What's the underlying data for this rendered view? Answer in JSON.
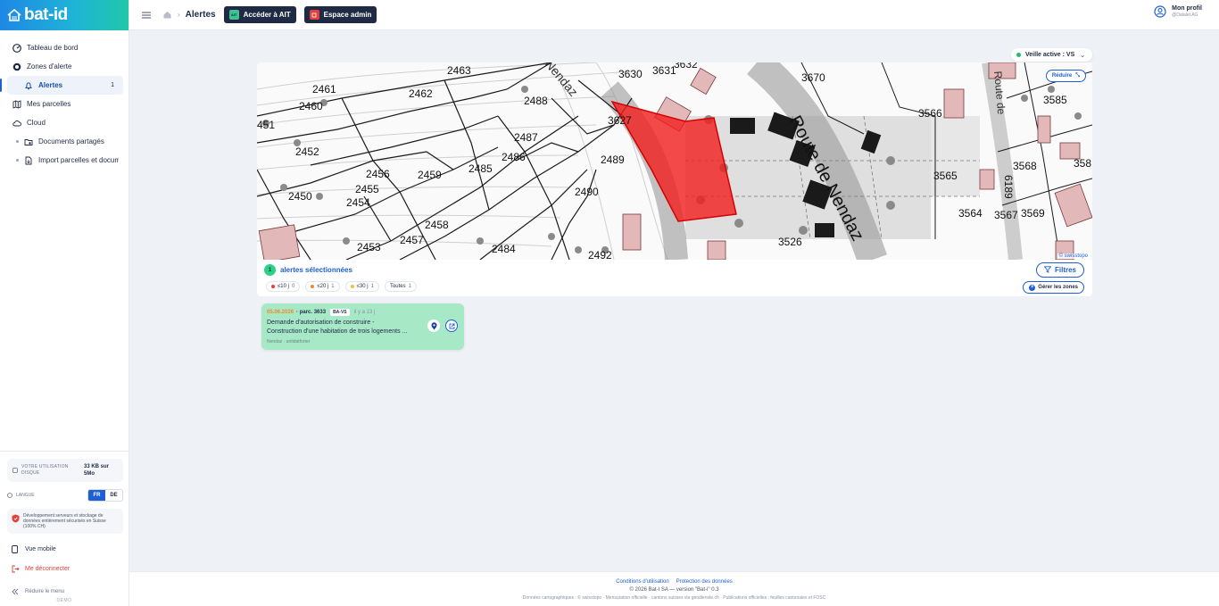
{
  "app": {
    "logo": "bat-id"
  },
  "sidebar": {
    "items": [
      {
        "label": "Tableau de bord",
        "icon": "dashboard-icon"
      },
      {
        "label": "Zones d'alerte",
        "icon": "target-icon"
      },
      {
        "label": "Alertes",
        "icon": "bell-icon",
        "count": "1",
        "active": true
      },
      {
        "label": "Mes parcelles",
        "icon": "map-icon"
      },
      {
        "label": "Cloud",
        "icon": "cloud-icon"
      },
      {
        "label": "Documents partagés",
        "icon": "shared-folder-icon"
      },
      {
        "label": "Import parcelles et documents",
        "icon": "import-file-icon"
      }
    ],
    "disk": {
      "label": "Votre utilisation disque",
      "value": "33 KB sur 5Mo"
    },
    "language": {
      "label": "Langue",
      "options": [
        "FR",
        "DE"
      ],
      "selected": "FR"
    },
    "security_note": "Développement serveurs et stockage de données entièrement sécurisés en Suisse (100% CH)",
    "mobile": "Vue mobile",
    "logout": "Me déconnecter",
    "reduce": "Réduire le menu",
    "env": "DEMO"
  },
  "topbar": {
    "breadcrumb": "Alertes",
    "ait_button": "Accéder à AIT",
    "ait_badge": "AIT",
    "admin_button": "Espace admin",
    "profile_name": "Mon profil",
    "profile_sub": "@Datalet AG"
  },
  "watch": {
    "label": "Veille active : VS"
  },
  "map": {
    "reduce_label": "Réduire",
    "attribution": "© swisstopo",
    "road_labels": [
      "Route de Nendaz",
      "Nendaz",
      "Route de"
    ],
    "parcels": [
      {
        "id": "2463"
      },
      {
        "id": "2461"
      },
      {
        "id": "2462"
      },
      {
        "id": "2460"
      },
      {
        "id": "2488"
      },
      {
        "id": "451"
      },
      {
        "id": "2487"
      },
      {
        "id": "2452"
      },
      {
        "id": "2486"
      },
      {
        "id": "2489"
      },
      {
        "id": "2456"
      },
      {
        "id": "2459"
      },
      {
        "id": "2485"
      },
      {
        "id": "2455"
      },
      {
        "id": "2450"
      },
      {
        "id": "2454"
      },
      {
        "id": "2490"
      },
      {
        "id": "2458"
      },
      {
        "id": "2457"
      },
      {
        "id": "2453"
      },
      {
        "id": "2484"
      },
      {
        "id": "2492"
      },
      {
        "id": "3630"
      },
      {
        "id": "3631"
      },
      {
        "id": "3632"
      },
      {
        "id": "3627"
      },
      {
        "id": "3670"
      },
      {
        "id": "3566"
      },
      {
        "id": "3585"
      },
      {
        "id": "3568"
      },
      {
        "id": "3565"
      },
      {
        "id": "3564"
      },
      {
        "id": "3567"
      },
      {
        "id": "3569"
      },
      {
        "id": "3526"
      },
      {
        "id": "358"
      },
      {
        "id": "6189"
      }
    ]
  },
  "selection": {
    "count": "1",
    "label": "alertes sélectionnées"
  },
  "filters_label": "Filtres",
  "chips": [
    {
      "label": "≤10 j",
      "count": "0",
      "color": "#e0413a"
    },
    {
      "label": "≤20 j",
      "count": "1",
      "color": "#f08a2a"
    },
    {
      "label": "≤30 j",
      "count": "1",
      "color": "#f2c230"
    },
    {
      "label": "Toutes",
      "count": "1",
      "color": ""
    }
  ],
  "zones_label": "Gérer les zones",
  "alert": {
    "date": "05.06.2026",
    "parcel": "· parc. 3633",
    "tag": "BA-VS",
    "ago": "il y a 13 j",
    "title_line1": "Demande d'autorisation de construire -",
    "title_line2": "Construction d'une habitation de trois logements ...",
    "meta": "Nendaz · antidatforter"
  },
  "footer": {
    "terms": "Conditions d'utilisation",
    "privacy": "Protection des données",
    "copyright": "© 2026 Bat-I SA — version \"Bat-i\" 0.3",
    "data_sources": "Données cartographiques : © swisstopo · Mensuration officielle · cantons suisses via geodienste.ch · Publications officielles : feuilles cantonales et FOSC"
  }
}
